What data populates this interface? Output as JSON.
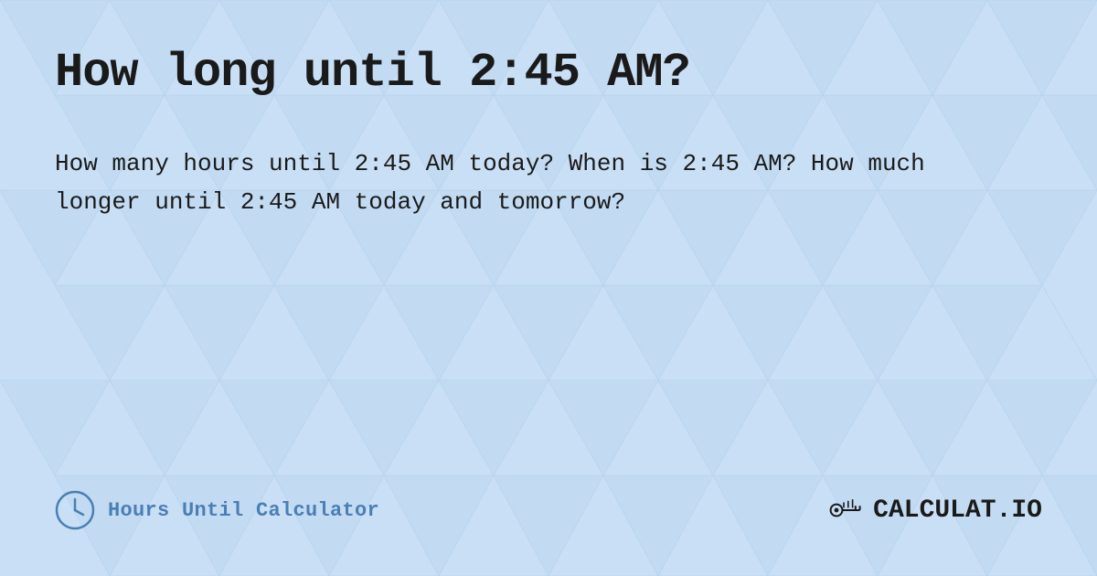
{
  "page": {
    "title": "How long until 2:45 AM?",
    "description": "How many hours until 2:45 AM today? When is 2:45 AM? How much longer until 2:45 AM today and tomorrow?",
    "background_color": "#c8dff5",
    "footer": {
      "calculator_label": "Hours Until Calculator",
      "logo_text": "CALCULAT.IO"
    }
  }
}
